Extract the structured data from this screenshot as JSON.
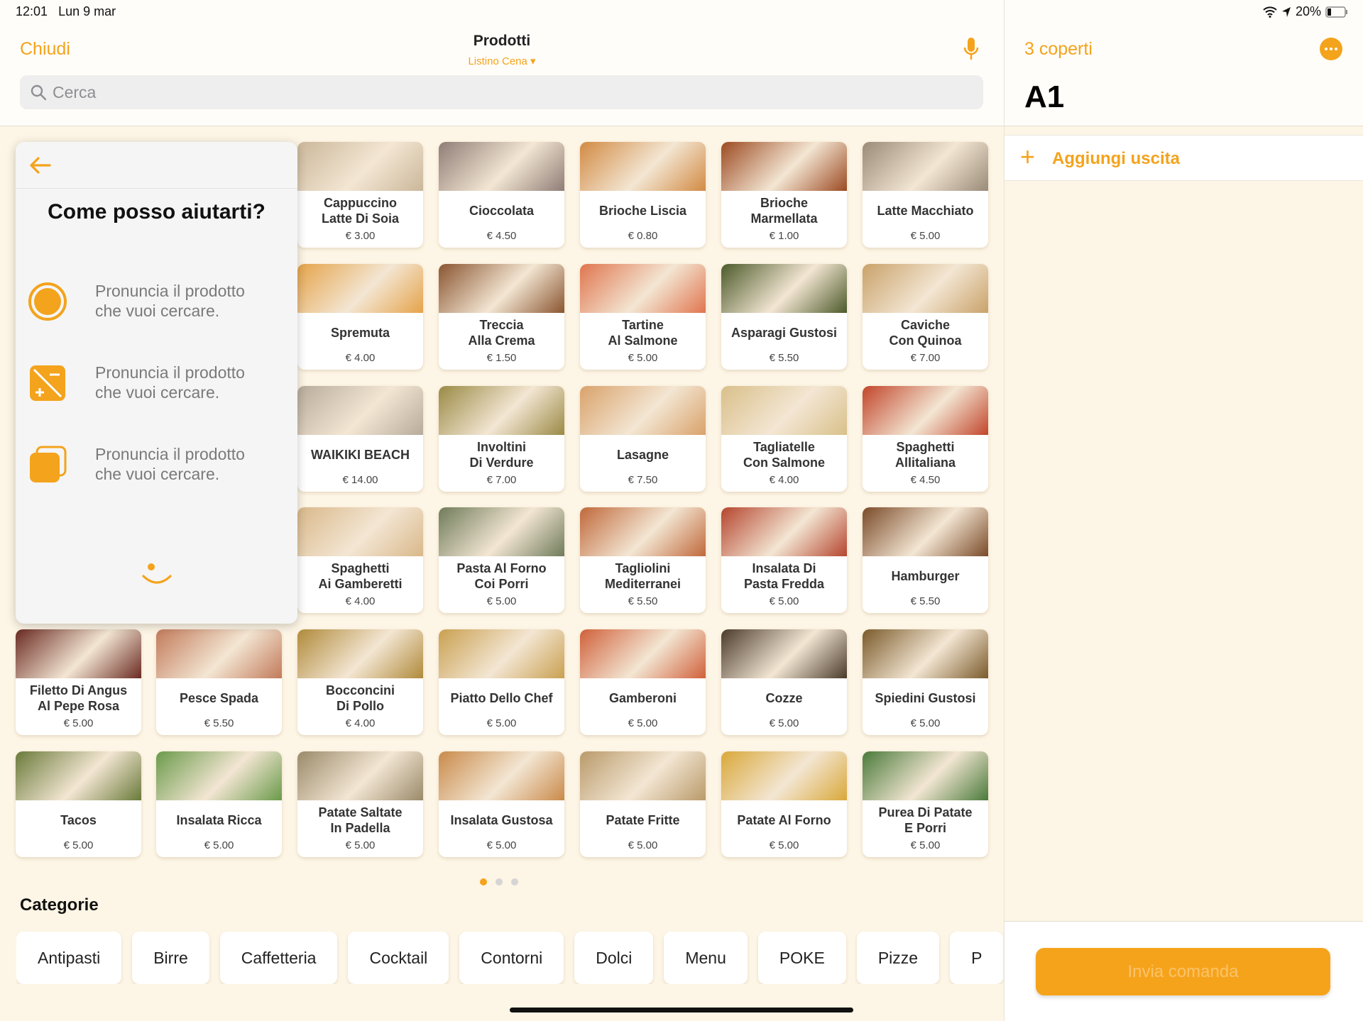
{
  "status_bar": {
    "time": "12:01",
    "date": "Lun 9 mar",
    "battery": "20%"
  },
  "header": {
    "close_label": "Chiudi",
    "title": "Prodotti",
    "price_list": "Listino Cena ▾",
    "search_placeholder": "Cerca"
  },
  "colors": {
    "accent": "#f4a31c",
    "background": "#fdf5e5"
  },
  "products": [
    [
      {
        "name": "Cappuccino\nLatte Di Soia",
        "price": "€ 3.00",
        "thumb": "#cbb79a"
      },
      {
        "name": "Cioccolata",
        "price": "€ 4.50",
        "thumb": "#8f7d76"
      },
      {
        "name": "Brioche Liscia",
        "price": "€ 0.80",
        "thumb": "#d28a43"
      },
      {
        "name": "Brioche\nMarmellata",
        "price": "€ 1.00",
        "thumb": "#9c4a22"
      },
      {
        "name": "Latte Macchiato",
        "price": "€ 5.00",
        "thumb": "#9a8a78"
      }
    ],
    [
      {
        "name": "Spremuta",
        "price": "€ 4.00",
        "thumb": "#e5a34a"
      },
      {
        "name": "Treccia\nAlla Crema",
        "price": "€ 1.50",
        "thumb": "#8a5530"
      },
      {
        "name": "Tartine\nAl Salmone",
        "price": "€ 5.00",
        "thumb": "#e0754e"
      },
      {
        "name": "Asparagi Gustosi",
        "price": "€ 5.50",
        "thumb": "#4c5a2a"
      },
      {
        "name": "Caviche\nCon Quinoa",
        "price": "€ 7.00",
        "thumb": "#c9a26a"
      }
    ],
    [
      {
        "name": "WAIKIKI BEACH",
        "price": "€ 14.00",
        "thumb": "#b7ab9b"
      },
      {
        "name": "Involtini\nDi Verdure",
        "price": "€ 7.00",
        "thumb": "#9a8a45"
      },
      {
        "name": "Lasagne",
        "price": "€ 7.50",
        "thumb": "#d9a26a"
      },
      {
        "name": "Tagliatelle\nCon Salmone",
        "price": "€ 4.00",
        "thumb": "#d9c08a"
      },
      {
        "name": "Spaghetti\nAllitaliana",
        "price": "€ 4.50",
        "thumb": "#c2452b"
      }
    ],
    [
      {
        "name": "Spaghetti\nAi Gamberetti",
        "price": "€ 4.00",
        "thumb": "#d9b88a"
      },
      {
        "name": "Pasta Al Forno\nCoi Porri",
        "price": "€ 5.00",
        "thumb": "#6f7b5a"
      },
      {
        "name": "Tagliolini\nMediterranei",
        "price": "€ 5.50",
        "thumb": "#c0683a"
      },
      {
        "name": "Insalata Di\nPasta Fredda",
        "price": "€ 5.00",
        "thumb": "#b5452e"
      },
      {
        "name": "Hamburger",
        "price": "€ 5.50",
        "thumb": "#7a4a28"
      }
    ],
    [
      {
        "name": "Filetto Di Angus\nAl Pepe Rosa",
        "price": "€ 5.00",
        "thumb": "#6a2a22"
      },
      {
        "name": "Pesce Spada",
        "price": "€ 5.50",
        "thumb": "#c27a5a"
      },
      {
        "name": "Bocconcini\nDi Pollo",
        "price": "€ 4.00",
        "thumb": "#b08a3a"
      },
      {
        "name": "Piatto Dello Chef",
        "price": "€ 5.00",
        "thumb": "#c9a050"
      },
      {
        "name": "Gamberoni",
        "price": "€ 5.00",
        "thumb": "#d0603a"
      },
      {
        "name": "Cozze",
        "price": "€ 5.00",
        "thumb": "#4a3a2a"
      },
      {
        "name": "Spiedini Gustosi",
        "price": "€ 5.00",
        "thumb": "#7a5a2a"
      }
    ],
    [
      {
        "name": "Tacos",
        "price": "€ 5.00",
        "thumb": "#6a7a3a"
      },
      {
        "name": "Insalata Ricca",
        "price": "€ 5.00",
        "thumb": "#6a9a4a"
      },
      {
        "name": "Patate Saltate\nIn Padella",
        "price": "€ 5.00",
        "thumb": "#9a8a6a"
      },
      {
        "name": "Insalata Gustosa",
        "price": "€ 5.00",
        "thumb": "#c98a4a"
      },
      {
        "name": "Patate Fritte",
        "price": "€ 5.00",
        "thumb": "#b99a6a"
      },
      {
        "name": "Patate Al Forno",
        "price": "€ 5.00",
        "thumb": "#d9a83a"
      },
      {
        "name": "Purea Di Patate\nE Porri",
        "price": "€ 5.00",
        "thumb": "#4a7a3a"
      }
    ]
  ],
  "voice_assistant": {
    "title": "Come posso aiutarti?",
    "tips": [
      {
        "icon": "record-circle-icon",
        "text": "Pronuncia il prodotto\nche vuoi cercare."
      },
      {
        "icon": "plus-minus-square-icon",
        "text": "Pronuncia il prodotto\nche vuoi cercare."
      },
      {
        "icon": "stacked-squares-icon",
        "text": "Pronuncia il prodotto\nche vuoi cercare."
      }
    ]
  },
  "pagination": {
    "pages": 3,
    "current": 1
  },
  "categories": {
    "title": "Categorie",
    "items": [
      "Antipasti",
      "Birre",
      "Caffetteria",
      "Cocktail",
      "Contorni",
      "Dolci",
      "Menu",
      "POKE",
      "Pizze",
      "P"
    ]
  },
  "order": {
    "covers": "3 coperti",
    "table": "A1",
    "add_course": "Aggiungi uscita",
    "send": "Invia comanda"
  }
}
